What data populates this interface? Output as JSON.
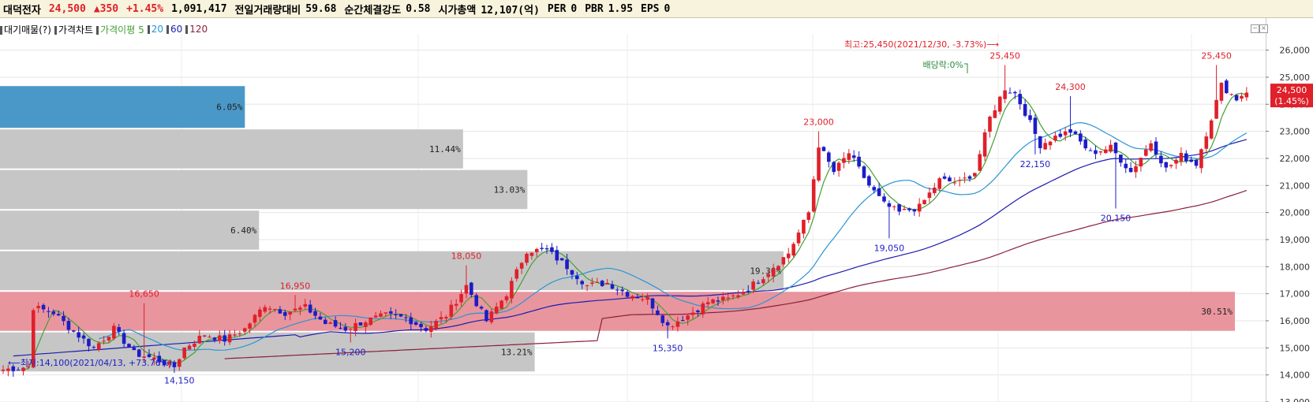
{
  "header": {
    "stock_name": "대덕전자",
    "price": "24,500",
    "change": "▲350",
    "change_pct": "+1.45%",
    "volume": "1,091,417",
    "vol_ratio_label": "전일거래량대비",
    "vol_ratio_value": "59.68",
    "strength_label": "순간체결강도",
    "strength_value": "0.58",
    "mktcap_label": "시가총액",
    "mktcap_value": "12,107(억)",
    "per_label": "PER",
    "per_value": "0",
    "pbr_label": "PBR",
    "pbr_value": "1.95",
    "eps_label": "EPS",
    "eps_value": "0"
  },
  "legend": {
    "volume_profile": "대기매물(?)",
    "price_chart": "가격차트",
    "ma_label": "가격이평",
    "ma5": "5",
    "ma20": "20",
    "ma60": "60",
    "ma120": "120"
  },
  "colors": {
    "up": "#e0202a",
    "down": "#1c1cc8",
    "ma5": "#44a035",
    "ma20": "#2a95d5",
    "ma60": "#1c1cb0",
    "ma120": "#8a1f38",
    "profile_gray": "#c6c6c6",
    "profile_current": "#e8959e",
    "profile_top": "#4a98c8"
  },
  "chart_data": {
    "type": "candlestick",
    "ylim": [
      13000,
      26600
    ],
    "y_ticks": [
      "13,000",
      "14,000",
      "15,000",
      "16,000",
      "17,000",
      "18,000",
      "19,000",
      "20,000",
      "21,000",
      "22,000",
      "23,000",
      "24,000",
      "25,000",
      "26,000"
    ],
    "current_price_label": "24,500",
    "current_pct_label": "(1.45%)",
    "volume_profile": [
      {
        "label": "13.21%",
        "low": 14100,
        "high": 15600,
        "pct": 13.21,
        "highlight": false
      },
      {
        "label": "30.51%",
        "low": 15600,
        "high": 17100,
        "pct": 30.51,
        "highlight": true
      },
      {
        "label": "19.36%",
        "low": 17100,
        "high": 18600,
        "pct": 19.36,
        "highlight": false
      },
      {
        "label": "6.40%",
        "low": 18600,
        "high": 20100,
        "pct": 6.4,
        "highlight": false
      },
      {
        "label": "13.03%",
        "low": 20100,
        "high": 21600,
        "pct": 13.03,
        "highlight": false
      },
      {
        "label": "11.44%",
        "low": 21600,
        "high": 23100,
        "pct": 11.44,
        "highlight": false
      },
      {
        "label": "6.05%",
        "low": 23100,
        "high": 24700,
        "pct": 6.05,
        "highlight": false,
        "top": true
      }
    ],
    "price_labels": [
      {
        "text": "16,650",
        "price": 16650,
        "index": 28,
        "type": "high"
      },
      {
        "text": "14,150",
        "price": 14150,
        "index": 35,
        "type": "low"
      },
      {
        "text": "16,950",
        "price": 16950,
        "index": 58,
        "type": "high"
      },
      {
        "text": "15,200",
        "price": 15200,
        "index": 69,
        "type": "low"
      },
      {
        "text": "18,050",
        "price": 18050,
        "index": 92,
        "type": "high"
      },
      {
        "text": "15,350",
        "price": 15350,
        "index": 132,
        "type": "low"
      },
      {
        "text": "23,000",
        "price": 23000,
        "index": 162,
        "type": "high"
      },
      {
        "text": "19,050",
        "price": 19050,
        "index": 176,
        "type": "low"
      },
      {
        "text": "25,450",
        "price": 25450,
        "index": 199,
        "type": "high"
      },
      {
        "text": "24,300",
        "price": 24300,
        "index": 212,
        "type": "high"
      },
      {
        "text": "22,150",
        "price": 22150,
        "index": 205,
        "type": "low"
      },
      {
        "text": "20,150",
        "price": 20150,
        "index": 221,
        "type": "low"
      },
      {
        "text": "25,450",
        "price": 25450,
        "index": 241,
        "type": "high"
      }
    ],
    "annotations": {
      "max_note": "최고:25,450(2021/12/30, -3.73%)⟶",
      "min_note": "⟵최저:14,100(2021/04/13, +73.76%)",
      "dividend_note": "배당락:0%"
    },
    "anchors": [
      [
        0,
        14200
      ],
      [
        5,
        14300
      ],
      [
        6,
        16500
      ],
      [
        10,
        16300
      ],
      [
        14,
        15600
      ],
      [
        18,
        15000
      ],
      [
        22,
        15700
      ],
      [
        26,
        14800
      ],
      [
        30,
        14600
      ],
      [
        34,
        14300
      ],
      [
        36,
        15000
      ],
      [
        40,
        15500
      ],
      [
        44,
        15300
      ],
      [
        48,
        15700
      ],
      [
        52,
        16600
      ],
      [
        56,
        16300
      ],
      [
        60,
        16500
      ],
      [
        64,
        15900
      ],
      [
        68,
        15700
      ],
      [
        72,
        16000
      ],
      [
        76,
        16200
      ],
      [
        80,
        16100
      ],
      [
        84,
        15700
      ],
      [
        88,
        16200
      ],
      [
        92,
        17300
      ],
      [
        96,
        16000
      ],
      [
        100,
        17000
      ],
      [
        104,
        18600
      ],
      [
        108,
        18600
      ],
      [
        112,
        18000
      ],
      [
        116,
        17300
      ],
      [
        120,
        17400
      ],
      [
        124,
        17000
      ],
      [
        128,
        16800
      ],
      [
        132,
        15800
      ],
      [
        136,
        16200
      ],
      [
        140,
        16700
      ],
      [
        144,
        16800
      ],
      [
        148,
        17200
      ],
      [
        152,
        17800
      ],
      [
        156,
        18500
      ],
      [
        160,
        20000
      ],
      [
        162,
        22500
      ],
      [
        165,
        21500
      ],
      [
        168,
        22200
      ],
      [
        172,
        21000
      ],
      [
        175,
        20300
      ],
      [
        178,
        20000
      ],
      [
        182,
        20200
      ],
      [
        186,
        21200
      ],
      [
        190,
        21100
      ],
      [
        193,
        21500
      ],
      [
        196,
        23500
      ],
      [
        199,
        24600
      ],
      [
        201,
        24400
      ],
      [
        203,
        23700
      ],
      [
        206,
        22500
      ],
      [
        209,
        22800
      ],
      [
        212,
        23000
      ],
      [
        216,
        22200
      ],
      [
        220,
        22400
      ],
      [
        224,
        21500
      ],
      [
        228,
        22600
      ],
      [
        231,
        21600
      ],
      [
        234,
        22100
      ],
      [
        237,
        21800
      ],
      [
        240,
        23500
      ],
      [
        242,
        24700
      ],
      [
        245,
        24200
      ],
      [
        247,
        24500
      ]
    ]
  }
}
